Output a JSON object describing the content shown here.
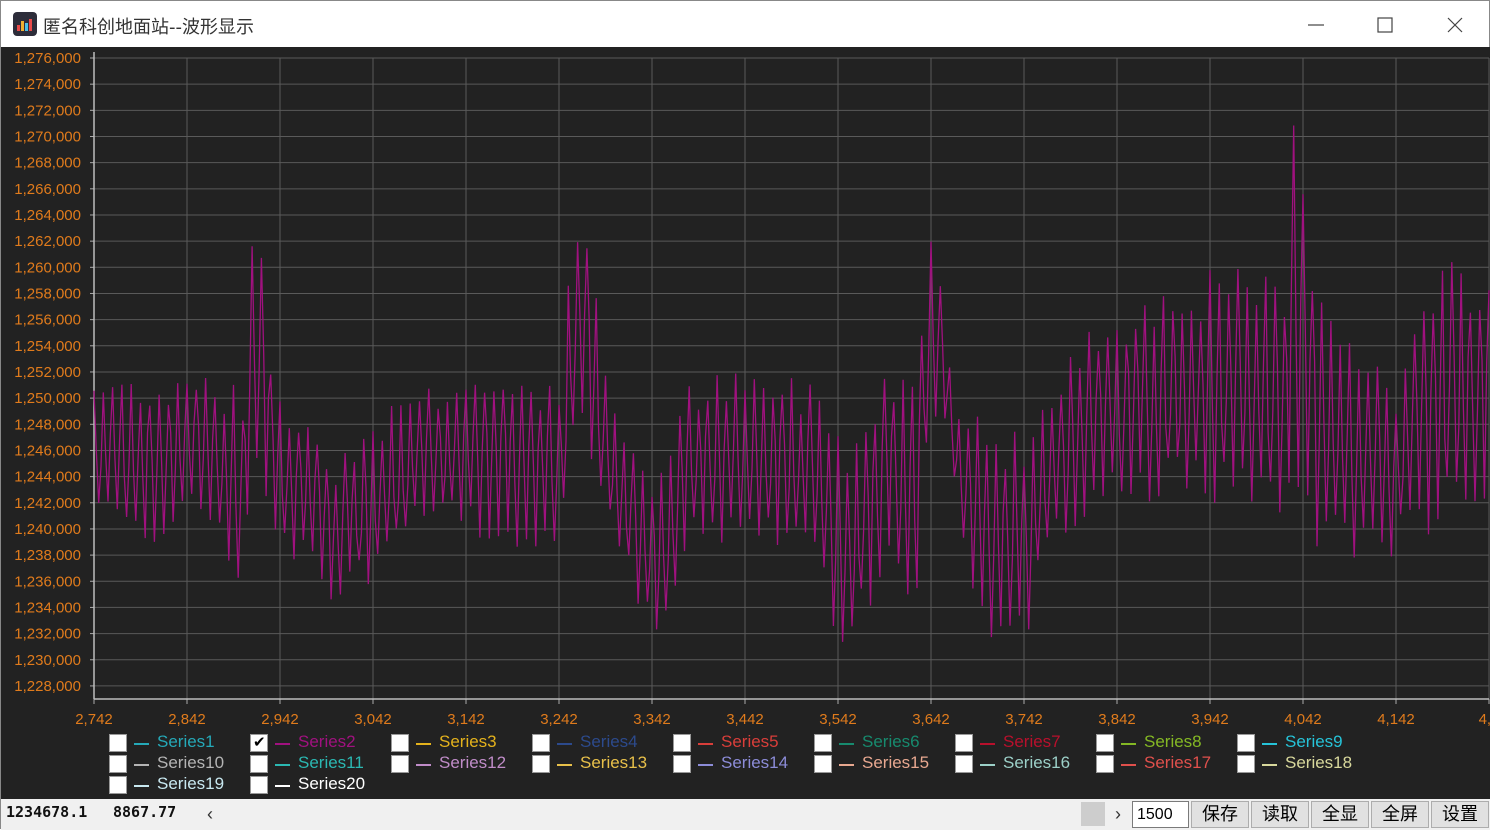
{
  "window": {
    "title": "匿名科创地面站--波形显示",
    "minimize_icon": "minimize-icon",
    "maximize_icon": "maximize-icon",
    "close_icon": "close-icon"
  },
  "colors": {
    "chart_bg": "#222222",
    "grid": "#5a5a5a",
    "axis_labels": "#e07b1c",
    "series2": "#a0117f"
  },
  "chart_data": {
    "type": "line",
    "title": "",
    "xlabel": "",
    "ylabel": "",
    "xlim": [
      2742,
      4242
    ],
    "ylim": [
      1227000,
      1276000
    ],
    "x_ticks": [
      "2,742",
      "2,842",
      "2,942",
      "3,042",
      "3,142",
      "3,242",
      "3,342",
      "3,442",
      "3,542",
      "3,642",
      "3,742",
      "3,842",
      "3,942",
      "4,042",
      "4,142",
      "4,2"
    ],
    "y_ticks": [
      "1,276,000",
      "1,274,000",
      "1,272,000",
      "1,270,000",
      "1,268,000",
      "1,266,000",
      "1,264,000",
      "1,262,000",
      "1,260,000",
      "1,258,000",
      "1,256,000",
      "1,254,000",
      "1,252,000",
      "1,250,000",
      "1,248,000",
      "1,246,000",
      "1,244,000",
      "1,242,000",
      "1,240,000",
      "1,238,000",
      "1,236,000",
      "1,234,000",
      "1,232,000",
      "1,230,000",
      "1,228,000"
    ],
    "grid": true,
    "legend_placement": "bottom",
    "series": [
      {
        "name": "Series2",
        "color": "#a0117f",
        "x": [
          2742,
          2782,
          2822,
          2842,
          2872,
          2902,
          2912,
          2922,
          2932,
          2952,
          2972,
          3002,
          3042,
          3082,
          3122,
          3162,
          3202,
          3242,
          3262,
          3272,
          3292,
          3312,
          3342,
          3362,
          3382,
          3402,
          3442,
          3482,
          3522,
          3542,
          3562,
          3582,
          3602,
          3622,
          3642,
          3662,
          3672,
          3692,
          3712,
          3742,
          3762,
          3782,
          3802,
          3822,
          3842,
          3872,
          3902,
          3942,
          3972,
          4002,
          4022,
          4032,
          4042,
          4062,
          4082,
          4102,
          4122,
          4142,
          4172,
          4202,
          4232
        ],
        "y_high": [
          1252000,
          1252000,
          1252000,
          1253000,
          1252500,
          1250500,
          1265000,
          1264000,
          1252000,
          1250000,
          1249000,
          1246000,
          1249000,
          1251000,
          1252000,
          1252000,
          1252000,
          1252000,
          1265500,
          1264500,
          1252000,
          1248500,
          1245000,
          1246500,
          1251500,
          1252000,
          1252000,
          1252000,
          1251500,
          1249000,
          1248000,
          1251000,
          1253000,
          1253000,
          1266000,
          1254000,
          1251000,
          1249000,
          1248000,
          1248500,
          1250000,
          1252000,
          1254500,
          1256500,
          1257500,
          1258500,
          1259500,
          1260000,
          1260000,
          1259500,
          1259000,
          1274000,
          1266500,
          1260000,
          1258000,
          1256500,
          1253000,
          1251000,
          1258500,
          1260500,
          1260500
        ],
        "y_low": [
          1239500,
          1239500,
          1238500,
          1240000,
          1240000,
          1233000,
          1244500,
          1244000,
          1240000,
          1237000,
          1236000,
          1234000,
          1235500,
          1239000,
          1239500,
          1239000,
          1238500,
          1238000,
          1246000,
          1245000,
          1240000,
          1236000,
          1232000,
          1231500,
          1238000,
          1238500,
          1238000,
          1238000,
          1237500,
          1228500,
          1231000,
          1235000,
          1238000,
          1229500,
          1247000,
          1246000,
          1238000,
          1232000,
          1230500,
          1230000,
          1235500,
          1238500,
          1240500,
          1241000,
          1241000,
          1241500,
          1241500,
          1241500,
          1241500,
          1241000,
          1240000,
          1242000,
          1242000,
          1237500,
          1237500,
          1236000,
          1236500,
          1238000,
          1239000,
          1240000,
          1241500
        ]
      }
    ]
  },
  "legend": [
    {
      "label": "Series1",
      "color": "#25a9b8",
      "checked": false
    },
    {
      "label": "Series2",
      "color": "#a0117f",
      "checked": true
    },
    {
      "label": "Series3",
      "color": "#e4b21c",
      "checked": false
    },
    {
      "label": "Series4",
      "color": "#2c4a8c",
      "checked": false
    },
    {
      "label": "Series5",
      "color": "#d93e3a",
      "checked": false
    },
    {
      "label": "Series6",
      "color": "#178a6e",
      "checked": false
    },
    {
      "label": "Series7",
      "color": "#b8102c",
      "checked": false
    },
    {
      "label": "Series8",
      "color": "#84b824",
      "checked": false
    },
    {
      "label": "Series9",
      "color": "#26c3d8",
      "checked": false
    },
    {
      "label": "Series10",
      "color": "#b4b4b4",
      "checked": false
    },
    {
      "label": "Series11",
      "color": "#2bb8b2",
      "checked": false
    },
    {
      "label": "Series12",
      "color": "#c08cc8",
      "checked": false
    },
    {
      "label": "Series13",
      "color": "#e8c04a",
      "checked": false
    },
    {
      "label": "Series14",
      "color": "#8c8cd8",
      "checked": false
    },
    {
      "label": "Series15",
      "color": "#e8a890",
      "checked": false
    },
    {
      "label": "Series16",
      "color": "#9cd0c8",
      "checked": false
    },
    {
      "label": "Series17",
      "color": "#e0504c",
      "checked": false
    },
    {
      "label": "Series18",
      "color": "#d8d89c",
      "checked": false
    },
    {
      "label": "Series19",
      "color": "#c8e8f0",
      "checked": false
    },
    {
      "label": "Series20",
      "color": "#ffffff",
      "checked": false
    }
  ],
  "status": {
    "value1": "1234678.1",
    "value2": "8867.77",
    "scroll_left_icon": "chevron-left-icon",
    "scroll_right_icon": "chevron-right-icon",
    "points": "1500",
    "buttons": [
      "保存",
      "读取",
      "全显",
      "全屏",
      "设置"
    ]
  }
}
